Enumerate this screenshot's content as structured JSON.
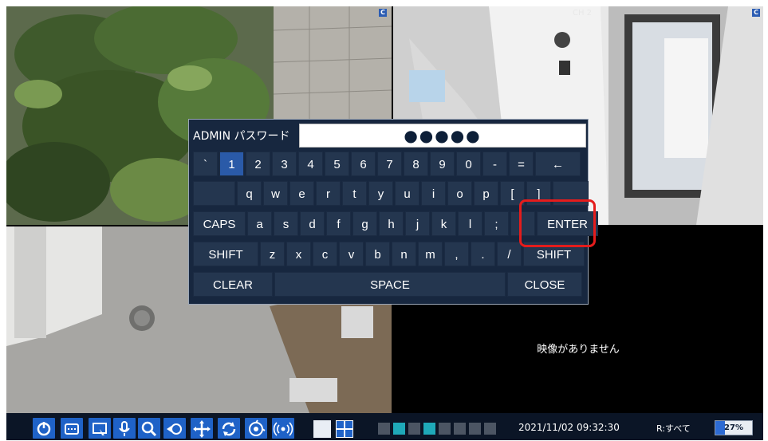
{
  "cameras": {
    "cam1_badge": "C",
    "cam2_badge": "C",
    "cam2_label": "CH 2",
    "cam4_message": "映像がありません"
  },
  "keyboard": {
    "label": "ADMIN パスワード",
    "password_masked": "●●●●●",
    "row1": [
      "`",
      "1",
      "2",
      "3",
      "4",
      "5",
      "6",
      "7",
      "8",
      "9",
      "0",
      "-",
      "=",
      "←"
    ],
    "row2": [
      "",
      "q",
      "w",
      "e",
      "r",
      "t",
      "y",
      "u",
      "i",
      "o",
      "p",
      "[",
      "]",
      ""
    ],
    "row3": [
      "CAPS",
      "a",
      "s",
      "d",
      "f",
      "g",
      "h",
      "j",
      "k",
      "l",
      ";",
      "",
      "ENTER"
    ],
    "row4": [
      "SHIFT",
      "z",
      "x",
      "c",
      "v",
      "b",
      "n",
      "m",
      ",",
      ".",
      "/",
      "SHIFT"
    ],
    "row5": [
      "CLEAR",
      "SPACE",
      "CLOSE"
    ],
    "selected_key": "1"
  },
  "taskbar": {
    "icons": [
      "power-icon",
      "osd-icon",
      "screen-select-icon",
      "microphone-icon",
      "search-icon",
      "playback-icon",
      "ptz-move-icon",
      "rotate-icon",
      "sequence-icon",
      "alarm-icon",
      "single-view-icon",
      "quad-view-icon"
    ],
    "datetime": "2021/11/02 09:32:30",
    "recording": "R:すべて",
    "disk_usage": "27%",
    "disk_usage_fraction": 0.27,
    "accent": "#1f62c7"
  },
  "highlight_color": "#e41c1c"
}
